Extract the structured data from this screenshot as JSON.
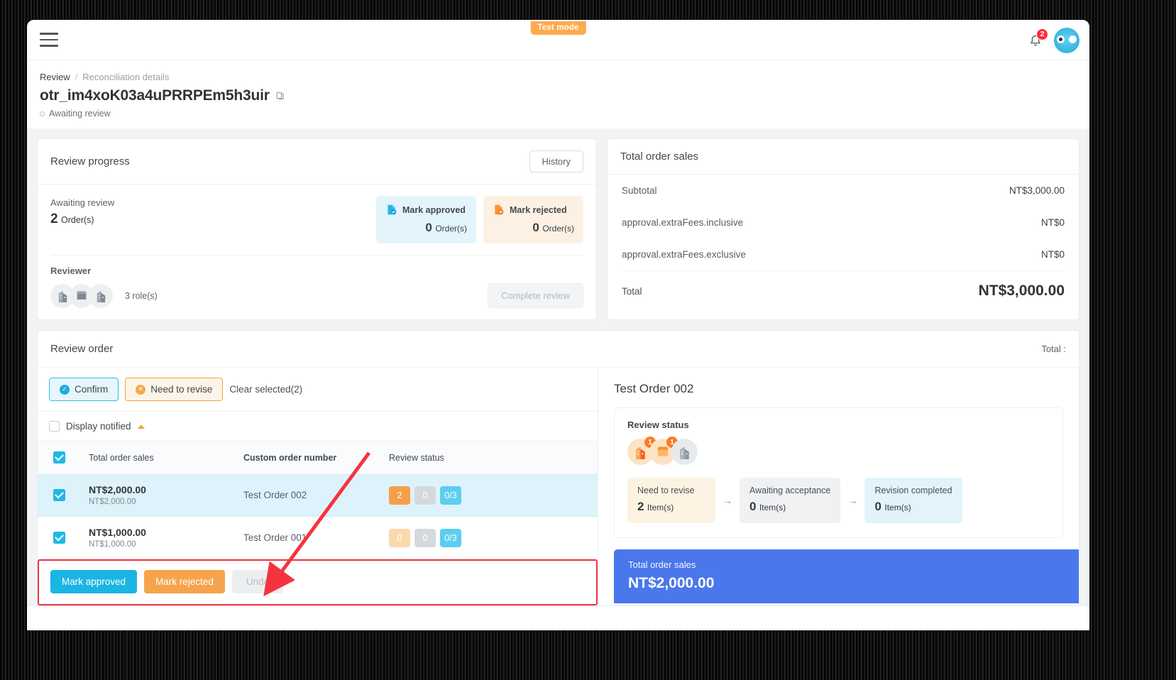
{
  "topbar": {
    "menu_icon": "hamburger-icon",
    "test_mode_badge": "Test mode",
    "bell_icon": "bell-icon",
    "notification_count": "2"
  },
  "breadcrumb": {
    "root": "Review",
    "separator": "/",
    "current": "Reconciliation details"
  },
  "page": {
    "title": "otr_im4xoK03a4uPRRPEm5h3uir",
    "copy_icon": "copy-icon",
    "status": "Awaiting review"
  },
  "review_progress": {
    "title": "Review progress",
    "history_button": "History",
    "awaiting_label": "Awaiting review",
    "awaiting_count": "2",
    "awaiting_unit": "Order(s)",
    "tiles": [
      {
        "icon": "approved-doc-icon",
        "label": "Mark approved",
        "count": "0",
        "unit": "Order(s)"
      },
      {
        "icon": "rejected-doc-icon",
        "label": "Mark rejected",
        "count": "0",
        "unit": "Order(s)"
      }
    ],
    "reviewer_label": "Reviewer",
    "roles_text": "3 role(s)",
    "complete_button": "Complete review"
  },
  "total_order_sales": {
    "title": "Total order sales",
    "rows": [
      {
        "label": "Subtotal",
        "value": "NT$3,000.00"
      },
      {
        "label": "approval.extraFees.inclusive",
        "value": "NT$0"
      },
      {
        "label": "approval.extraFees.exclusive",
        "value": "NT$0"
      }
    ],
    "total_label": "Total",
    "total_value": "NT$3,000.00"
  },
  "review_order": {
    "title": "Review order",
    "header_right": "Total :",
    "toolbar": {
      "confirm": "Confirm",
      "need_to_revise": "Need to revise",
      "clear_selected": "Clear selected(2)"
    },
    "display_notified": "Display notified",
    "columns": [
      "Total order sales",
      "Custom order number",
      "Review status"
    ],
    "rows": [
      {
        "selected": true,
        "amount": "NT$2,000.00",
        "amount_sub": "NT$2,000.00",
        "order_number": "Test Order 002",
        "pills": [
          "2",
          "0",
          "0/3"
        ]
      },
      {
        "selected": true,
        "amount": "NT$1,000.00",
        "amount_sub": "NT$1,000.00",
        "order_number": "Test Order 001",
        "pills": [
          "0",
          "0",
          "0/3"
        ]
      }
    ],
    "footer": {
      "mark_approved": "Mark approved",
      "mark_rejected": "Mark rejected",
      "undo": "Undo"
    }
  },
  "order_detail": {
    "title": "Test Order 002",
    "review_status_title": "Review status",
    "avatar_badges": [
      "1",
      "1",
      ""
    ],
    "steps": [
      {
        "label": "Need to revise",
        "count": "2",
        "unit": "Item(s)"
      },
      {
        "label": "Awaiting acceptance",
        "count": "0",
        "unit": "Item(s)"
      },
      {
        "label": "Revision completed",
        "count": "0",
        "unit": "Item(s)"
      }
    ],
    "arrow": "→",
    "blue_panel": {
      "label": "Total order sales",
      "value": "NT$2,000.00"
    }
  },
  "colors": {
    "accent_blue": "#1ab5e3",
    "accent_orange": "#f5a44d",
    "brand_blue": "#4a77eb",
    "annotation_red": "#f5333f",
    "test_mode": "#ffa94d",
    "badge_red": "#ff2d3d"
  }
}
